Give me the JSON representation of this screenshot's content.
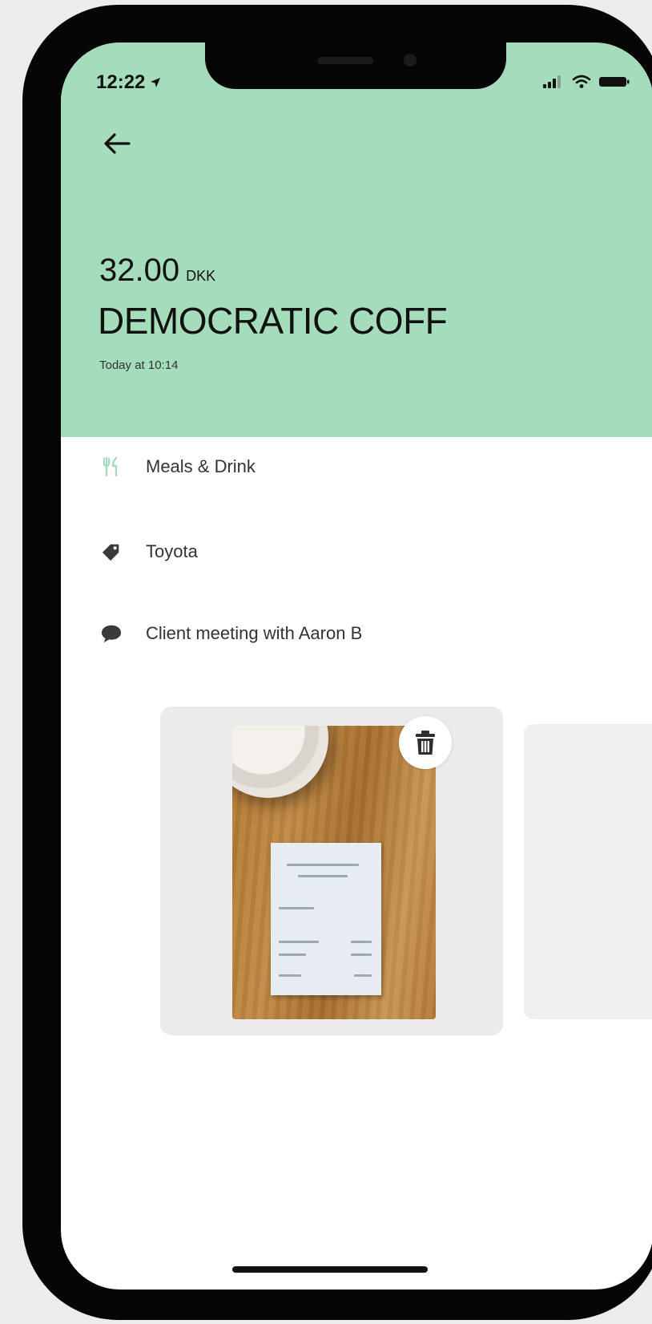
{
  "status_bar": {
    "time": "12:22",
    "location_icon": "location-arrow-icon",
    "signal_icon": "cellular-signal-icon",
    "wifi_icon": "wifi-icon",
    "battery_icon": "battery-icon"
  },
  "header": {
    "back_icon": "arrow-left-icon",
    "amount": "32.00",
    "currency": "DKK",
    "merchant": "DEMOCRATIC COFF",
    "date": "Today at 10:14",
    "background_color": "#a5ddbc"
  },
  "details": {
    "category": {
      "icon": "fork-knife-icon",
      "label": "Meals & Drink",
      "icon_color": "#a5ddbc"
    },
    "tag": {
      "icon": "tag-icon",
      "label": "Toyota"
    },
    "note": {
      "icon": "speech-bubble-icon",
      "label": "Client meeting with Aaron B"
    }
  },
  "receipt": {
    "delete_icon": "trash-icon"
  }
}
